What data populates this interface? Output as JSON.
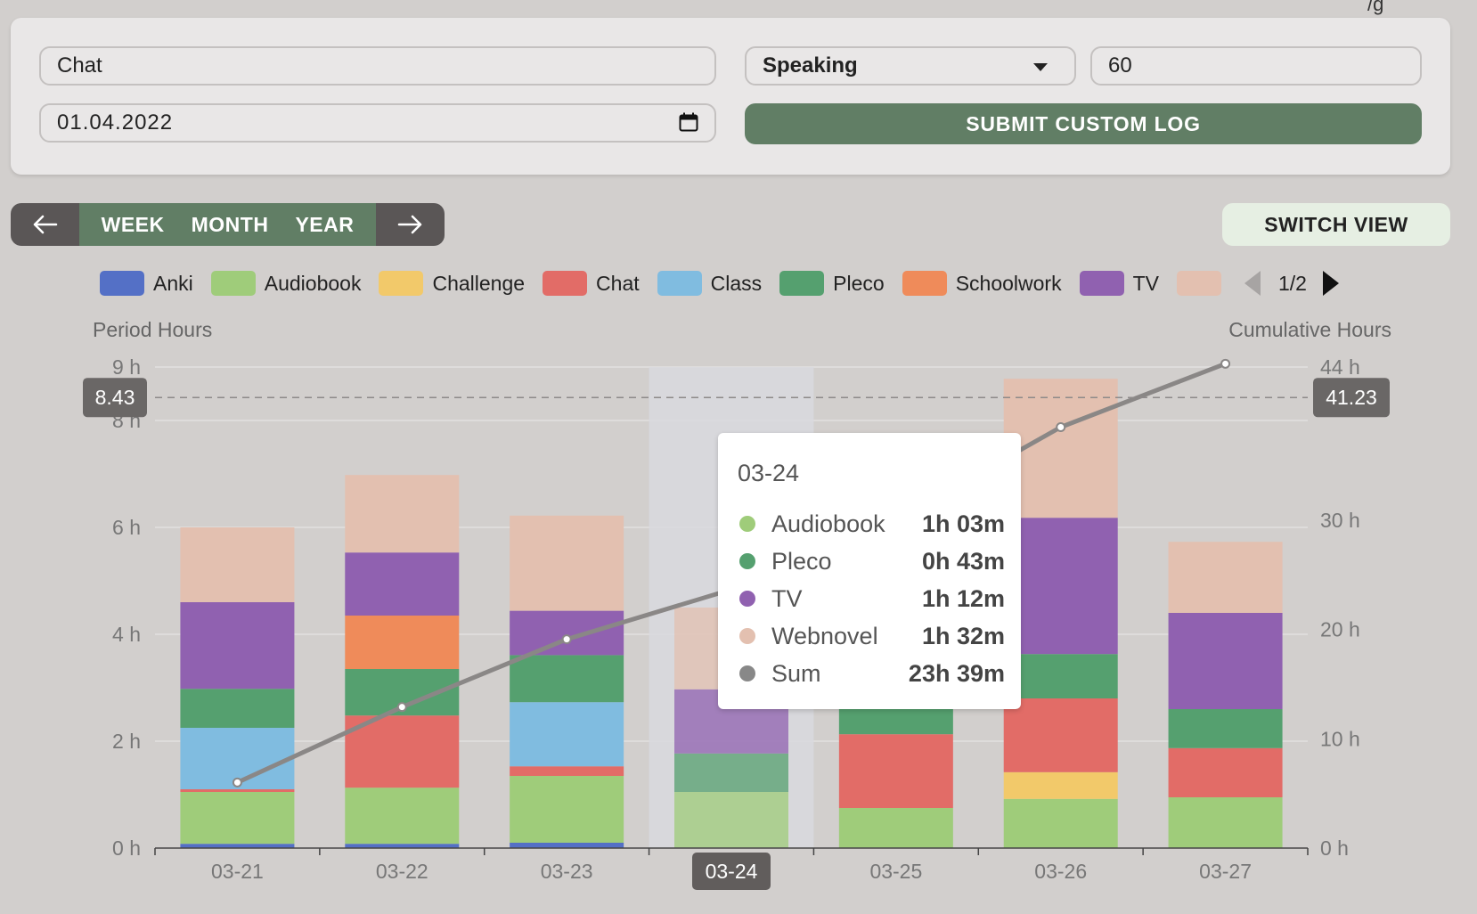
{
  "form": {
    "activity_value": "Chat",
    "date_value": "01.04.2022",
    "category_value": "Speaking",
    "minutes_value": "60",
    "submit_label": "SUBMIT CUSTOM LOG"
  },
  "period": {
    "prev_icon": "arrow-left-icon",
    "next_icon": "arrow-right-icon",
    "items": [
      "WEEK",
      "MONTH",
      "YEAR"
    ]
  },
  "switch_view_label": "SWITCH VIEW",
  "legend": {
    "items": [
      {
        "label": "Anki",
        "color": "#5470c6"
      },
      {
        "label": "Audiobook",
        "color": "#9fcc7a"
      },
      {
        "label": "Challenge",
        "color": "#f2c96a"
      },
      {
        "label": "Chat",
        "color": "#e26c67"
      },
      {
        "label": "Class",
        "color": "#80bce0"
      },
      {
        "label": "Pleco",
        "color": "#55a06f"
      },
      {
        "label": "Schoolwork",
        "color": "#ef8b5a"
      },
      {
        "label": "TV",
        "color": "#9061b0"
      },
      {
        "label": "",
        "color": "#e3c0b0"
      }
    ],
    "page": "1/2"
  },
  "chart_data": {
    "type": "bar",
    "left_axis_title": "Period Hours",
    "right_axis_title": "Cumulative Hours",
    "left_ticks": [
      "0 h",
      "2 h",
      "4 h",
      "6 h",
      "8 h",
      "9 h"
    ],
    "right_ticks": [
      "0 h",
      "10 h",
      "20 h",
      "30 h",
      "44 h"
    ],
    "ylim_left": [
      0,
      9
    ],
    "ylim_right": [
      0,
      44
    ],
    "categories": [
      "03-21",
      "03-22",
      "03-23",
      "03-24",
      "03-25",
      "03-26",
      "03-27"
    ],
    "selected_category": "03-24",
    "series": [
      {
        "name": "Anki",
        "color": "#5470c6",
        "values": [
          0.08,
          0.08,
          0.1,
          0,
          0,
          0,
          0
        ]
      },
      {
        "name": "Audiobook",
        "color": "#9fcc7a",
        "values": [
          0.97,
          1.05,
          1.25,
          1.05,
          0.75,
          0.92,
          0.95
        ]
      },
      {
        "name": "Challenge",
        "color": "#f2c96a",
        "values": [
          0,
          0,
          0,
          0,
          0,
          0.5,
          0
        ]
      },
      {
        "name": "Chat",
        "color": "#e26c67",
        "values": [
          0.05,
          1.35,
          0.18,
          0,
          1.38,
          1.38,
          0.92
        ]
      },
      {
        "name": "Class",
        "color": "#80bce0",
        "values": [
          1.15,
          0,
          1.2,
          0,
          0,
          0,
          0
        ]
      },
      {
        "name": "Pleco",
        "color": "#55a06f",
        "values": [
          0.73,
          0.87,
          0.88,
          0.72,
          0.9,
          0.83,
          0.73
        ]
      },
      {
        "name": "Schoolwork",
        "color": "#ef8b5a",
        "values": [
          0,
          1.0,
          0,
          0,
          0,
          0,
          0
        ]
      },
      {
        "name": "TV",
        "color": "#9061b0",
        "values": [
          1.62,
          1.18,
          0.83,
          1.2,
          1.1,
          2.55,
          1.8
        ]
      },
      {
        "name": "Webnovel",
        "color": "#e3c0b0",
        "values": [
          1.4,
          1.45,
          1.78,
          1.53,
          0.5,
          2.6,
          1.33
        ]
      }
    ],
    "cumulative": [
      6.0,
      12.9,
      19.1,
      23.65,
      30.0,
      38.5,
      44.3
    ],
    "marker_left": "8.43",
    "marker_right": "41.23",
    "marker_value_left": 8.43,
    "grid": true
  },
  "tooltip": {
    "date": "03-24",
    "rows": [
      {
        "name": "Audiobook",
        "value": "1h 03m",
        "color": "#9fcc7a"
      },
      {
        "name": "Pleco",
        "value": "0h 43m",
        "color": "#55a06f"
      },
      {
        "name": "TV",
        "value": "1h 12m",
        "color": "#9061b0"
      },
      {
        "name": "Webnovel",
        "value": "1h 32m",
        "color": "#e3c0b0"
      },
      {
        "name": "Sum",
        "value": "23h 39m",
        "color": "#888888"
      }
    ]
  }
}
